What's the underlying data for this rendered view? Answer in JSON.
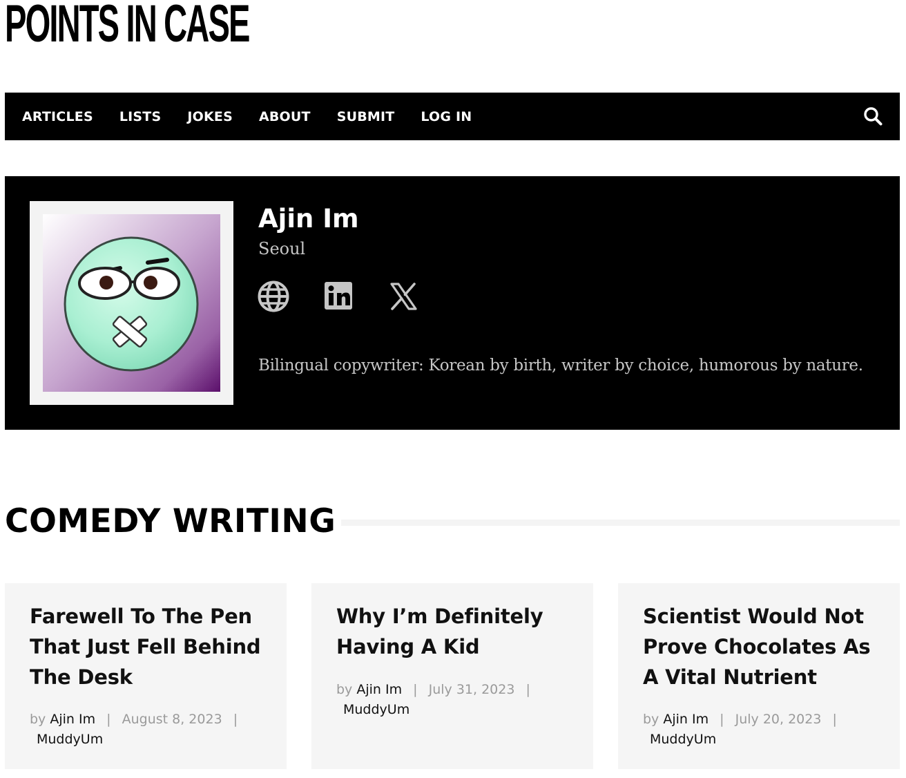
{
  "site": {
    "logo_text": "POINTS IN CASE"
  },
  "nav": {
    "items": [
      {
        "label": "ARTICLES"
      },
      {
        "label": "LISTS"
      },
      {
        "label": "JOKES"
      },
      {
        "label": "ABOUT"
      },
      {
        "label": "SUBMIT"
      },
      {
        "label": "LOG IN"
      }
    ],
    "search_icon": "search-icon"
  },
  "author": {
    "name": "Ajin Im",
    "location": "Seoul",
    "bio": "Bilingual copywriter: Korean by birth, writer by choice, humorous by nature.",
    "social": [
      {
        "icon": "globe-icon"
      },
      {
        "icon": "linkedin-icon"
      },
      {
        "icon": "x-icon"
      }
    ],
    "avatar_icon": "sealed-mouth-smiley-avatar"
  },
  "section": {
    "title": "COMEDY WRITING"
  },
  "articles": [
    {
      "title": "Farewell To The Pen That Just Fell Behind The Desk",
      "by": "by",
      "author": "Ajin Im",
      "sep1": "|",
      "date": "August 8, 2023",
      "sep2": "|",
      "editor": "MuddyUm"
    },
    {
      "title": "Why I’m Definitely Having A Kid",
      "by": "by",
      "author": "Ajin Im",
      "sep1": "|",
      "date": "July 31, 2023",
      "sep2": "|",
      "editor": "MuddyUm"
    },
    {
      "title": "Scientist Would Not Prove Chocolates As A Vital Nutrient",
      "by": "by",
      "author": "Ajin Im",
      "sep1": "|",
      "date": "July 20, 2023",
      "sep2": "|",
      "editor": "MuddyUm"
    }
  ],
  "colors": {
    "nav_bg": "#000000",
    "author_box_bg": "#000000",
    "card_bg": "#f5f5f5",
    "meta_gray": "#9a9a9a",
    "avatar_face": "#a9efd2",
    "avatar_bg_dark": "#5b0f6b"
  }
}
